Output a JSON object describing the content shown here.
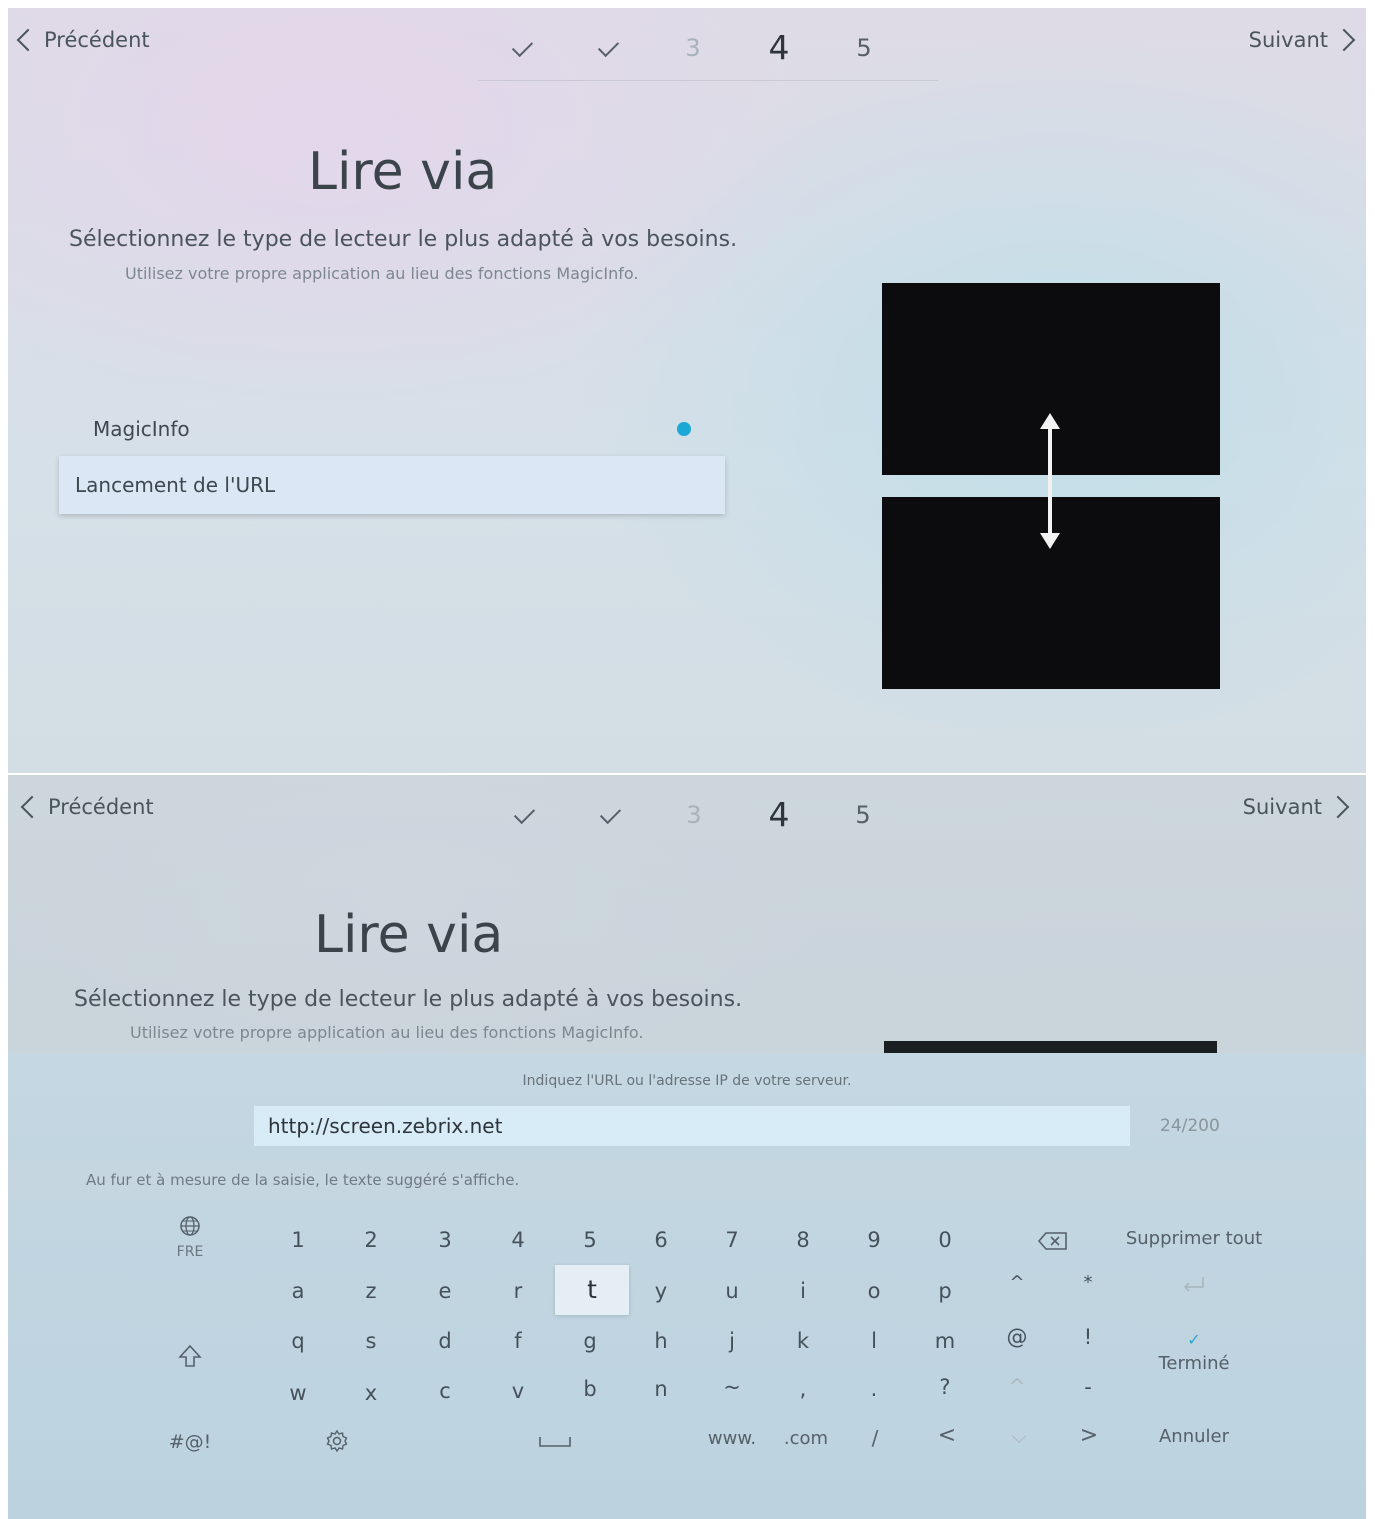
{
  "nav": {
    "prev_label": "Précédent",
    "next_label": "Suivant"
  },
  "steps": {
    "step3": "3",
    "step4": "4",
    "step5": "5"
  },
  "page": {
    "title": "Lire via",
    "subtitle": "Sélectionnez le type de lecteur le plus adapté à vos besoins.",
    "hint": "Utilisez votre propre application au lieu des fonctions MagicInfo."
  },
  "options": [
    {
      "label": "MagicInfo",
      "selected": true
    },
    {
      "label": "Lancement de l'URL",
      "focused": true
    }
  ],
  "keyboard_panel": {
    "prompt": "Indiquez l'URL ou l'adresse IP de votre serveur.",
    "url_value": "http://screen.zebrix.net",
    "char_count": "24/200",
    "suggestion_hint": "Au fur et à mesure de la saisie, le texte suggéré s'affiche.",
    "language": "FRE",
    "row_digits": [
      "1",
      "2",
      "3",
      "4",
      "5",
      "6",
      "7",
      "8",
      "9",
      "0"
    ],
    "row_top_letters": [
      "a",
      "z",
      "e",
      "r",
      "t",
      "y",
      "u",
      "i",
      "o",
      "p",
      "^",
      "*"
    ],
    "row_mid_letters": [
      "q",
      "s",
      "d",
      "f",
      "g",
      "h",
      "j",
      "k",
      "l",
      "m",
      "@",
      "!"
    ],
    "row_bottom_letters": [
      "w",
      "x",
      "c",
      "v",
      "b",
      "n",
      "~",
      ",",
      ".",
      "?",
      "^",
      "-"
    ],
    "row_function": {
      "symbols": "#@!",
      "www": "www.",
      "com": ".com",
      "slash": "/",
      "lt": "<",
      "gt": ">"
    },
    "delete_all": "Supprimer tout",
    "done": "Terminé",
    "cancel": "Annuler"
  },
  "colors": {
    "accent": "#1aa9d4",
    "focus_bg": "#dbe7f4"
  }
}
